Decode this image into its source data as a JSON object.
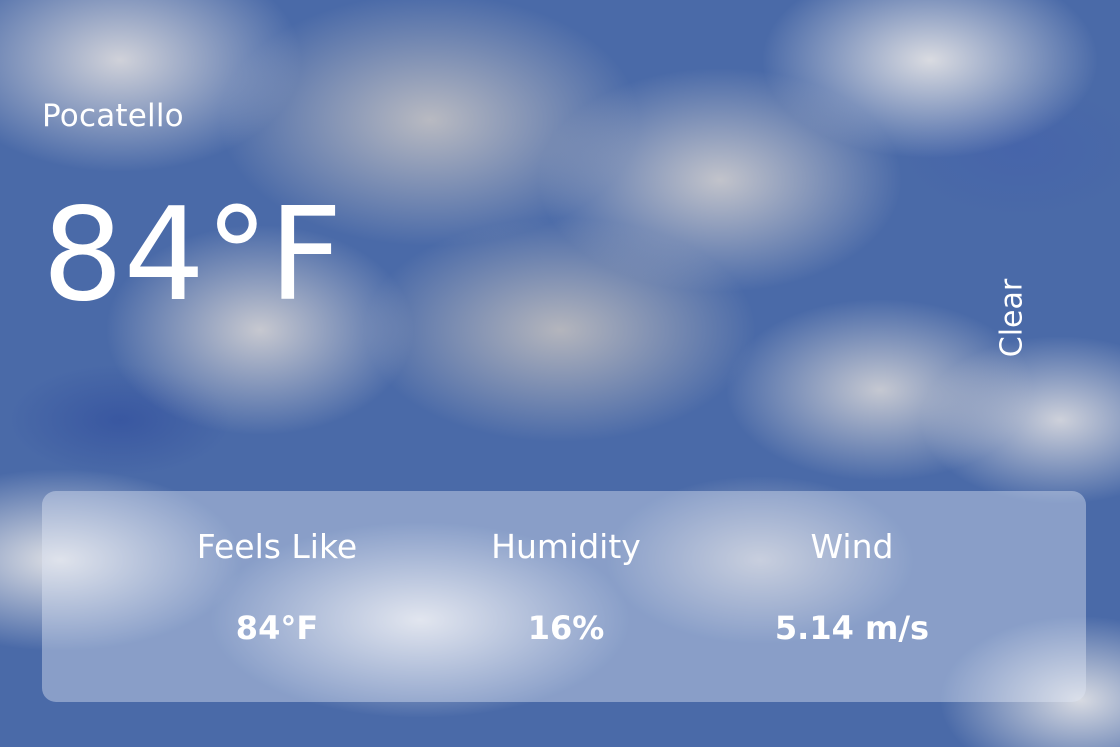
{
  "weather": {
    "city": "Pocatello",
    "temperature": "84°F",
    "condition": "Clear"
  },
  "details": {
    "feels_like": {
      "label": "Feels Like",
      "value": "84°F"
    },
    "humidity": {
      "label": "Humidity",
      "value": "16%"
    },
    "wind": {
      "label": "Wind",
      "value": "5.14 m/s"
    }
  },
  "colors": {
    "text": "#ffffff",
    "sky_blue": "#4a6aa8"
  }
}
